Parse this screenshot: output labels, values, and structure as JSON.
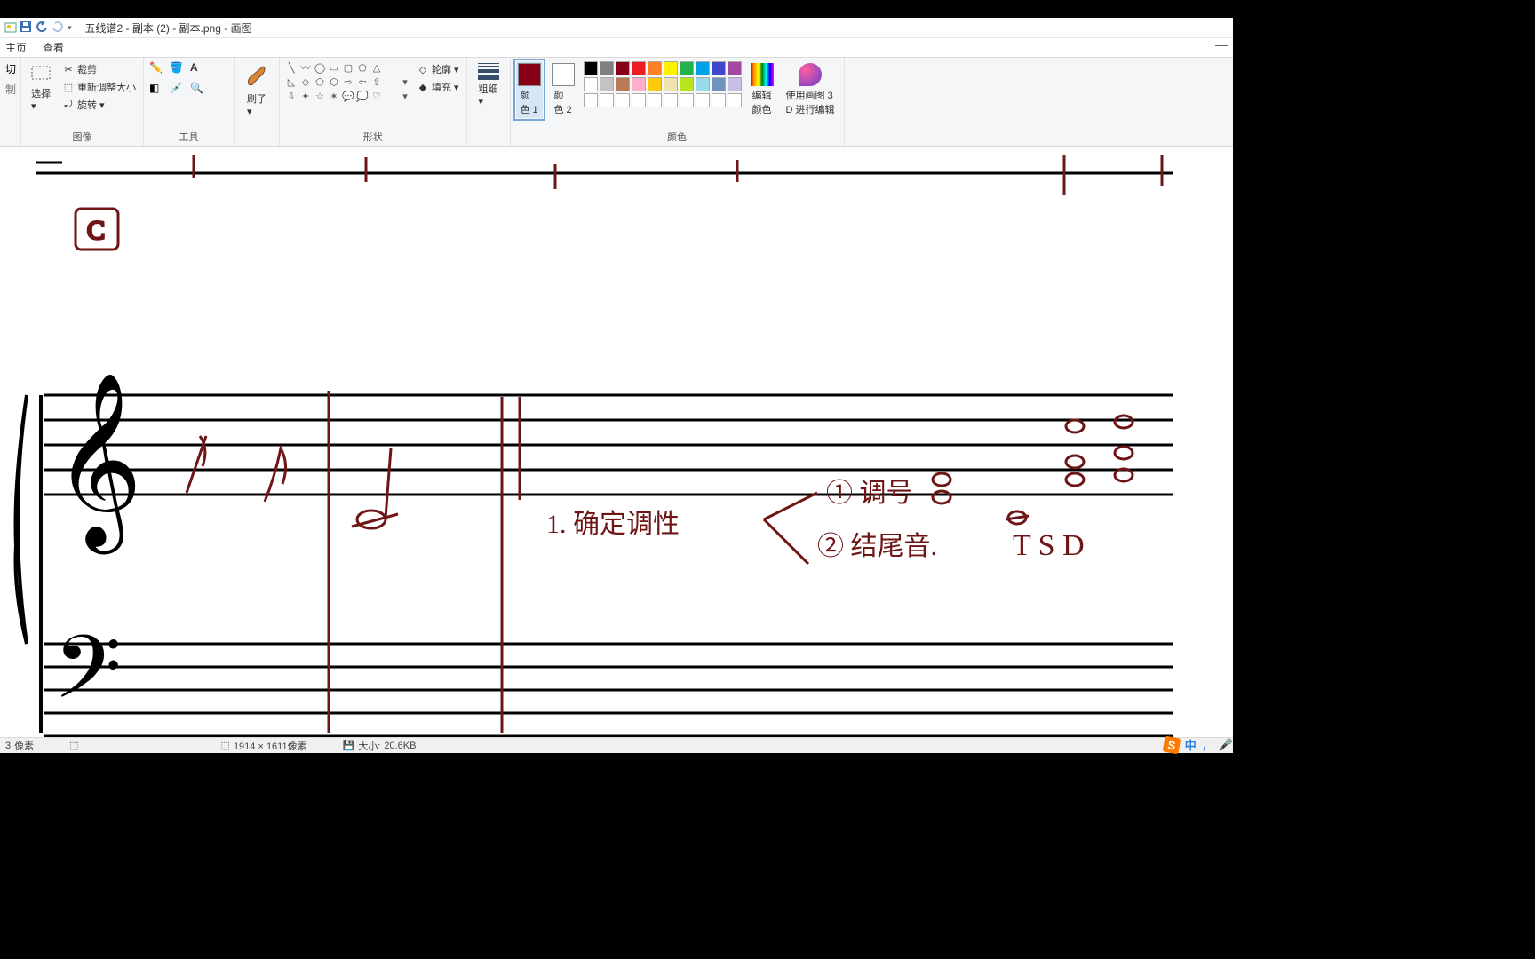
{
  "title_bar": {
    "filename": "五线谱2 - 副本 (2) - 副本.png",
    "app_name": "画图",
    "separator": " - "
  },
  "tabs": {
    "home": "主页",
    "view": "查看"
  },
  "ribbon": {
    "clipboard": {
      "cut": "切",
      "copy": "制",
      "label": ""
    },
    "select": {
      "label": "选择",
      "dropdown": "▾"
    },
    "image": {
      "crop": "裁剪",
      "resize": "重新调整大小",
      "rotate": "旋转",
      "dropdown": "▾",
      "label": "图像"
    },
    "tools": {
      "label": "工具"
    },
    "brush": {
      "label": "刷子",
      "dropdown": "▾"
    },
    "shapes": {
      "outline": "轮廓",
      "fill": "填充",
      "dropdown": "▾",
      "label": "形状"
    },
    "thickness": {
      "label": "粗细",
      "dropdown": "▾"
    },
    "color1": {
      "label_a": "颜",
      "label_b": "色 1"
    },
    "color2": {
      "label_a": "颜",
      "label_b": "色 2"
    },
    "colors_label": "颜色",
    "edit_colors": {
      "line1": "编辑",
      "line2": "颜色"
    },
    "paint3d": {
      "line1": "使用画图 3",
      "line2": "D 进行编辑"
    }
  },
  "palette": {
    "row1": [
      "#000000",
      "#7f7f7f",
      "#880015",
      "#ed1c24",
      "#ff7f27",
      "#fff200",
      "#22b14c",
      "#00a2e8",
      "#3f48cc",
      "#a349a4"
    ],
    "row2": [
      "#ffffff",
      "#c3c3c3",
      "#b97a57",
      "#ffaec9",
      "#ffc90e",
      "#efe4b0",
      "#b5e61d",
      "#99d9ea",
      "#7092be",
      "#c8bfe7"
    ],
    "row3": [
      "#ffffff",
      "#ffffff",
      "#ffffff",
      "#ffffff",
      "#ffffff",
      "#ffffff",
      "#ffffff",
      "#ffffff",
      "#ffffff",
      "#ffffff"
    ]
  },
  "color1_value": "#880015",
  "color2_value": "#ffffff",
  "status": {
    "pos_suffix": "像素",
    "pos_value": "3",
    "dim": "1914 × 1611像素",
    "size_label": "大小:",
    "size_value": "20.6KB"
  },
  "ime": {
    "lang": "中",
    "punct": "，",
    "mic": "🎤"
  },
  "window_min": "—"
}
